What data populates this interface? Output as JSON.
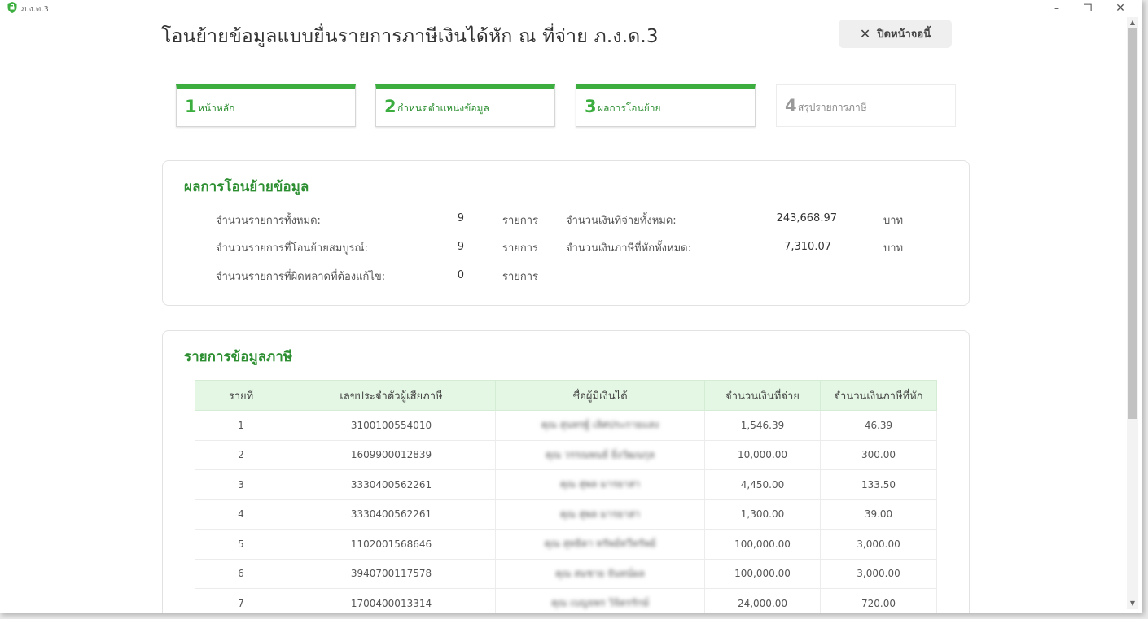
{
  "window": {
    "app_name": "ภ.ง.ด.3",
    "minimize": "–",
    "restore": "❐",
    "close": "✕"
  },
  "header": {
    "title": "โอนย้ายข้อมูลแบบยื่นรายการภาษีเงินได้หัก ณ ที่จ่าย ภ.ง.ด.3",
    "close_button": "ปิดหน้าจอนี้",
    "close_icon": "✕"
  },
  "steps": [
    {
      "number": "1",
      "label": "หน้าหลัก",
      "state": "done"
    },
    {
      "number": "2",
      "label": "กำหนดตำแหน่งข้อมูล",
      "state": "done"
    },
    {
      "number": "3",
      "label": "ผลการโอนย้าย",
      "state": "current"
    },
    {
      "number": "4",
      "label": "สรุปรายการภาษี",
      "state": "pending"
    }
  ],
  "summary": {
    "title": "ผลการโอนย้ายข้อมูล",
    "total_items_label": "จำนวนรายการทั้งหมด:",
    "total_items_value": "9",
    "complete_items_label": "จำนวนรายการที่โอนย้ายสมบูรณ์:",
    "complete_items_value": "9",
    "error_items_label": "จำนวนรายการที่ผิดพลาดที่ต้องแก้ไข:",
    "error_items_value": "0",
    "items_unit": "รายการ",
    "total_paid_label": "จำนวนเงินที่จ่ายทั้งหมด:",
    "total_paid_value": "243,668.97",
    "total_tax_label": "จำนวนเงินภาษีที่หักทั้งหมด:",
    "total_tax_value": "7,310.07",
    "money_unit": "บาท"
  },
  "tax_table": {
    "title": "รายการข้อมูลภาษี",
    "columns": [
      "รายที่",
      "เลขประจำตัวผู้เสียภาษี",
      "ชื่อผู้มีเงินได้",
      "จำนวนเงินที่จ่าย",
      "จำนวนเงินภาษีที่หัก"
    ],
    "rows": [
      {
        "no": "1",
        "tax_id": "3100100554010",
        "name": "คุณ สุนทรฐ์ เลิศประกายแสง",
        "paid": "1,546.39",
        "tax": "46.39"
      },
      {
        "no": "2",
        "tax_id": "1609900012839",
        "name": "คุณ วรรณพนธ์ ยิ่งวัฒนกุล",
        "paid": "10,000.00",
        "tax": "300.00"
      },
      {
        "no": "3",
        "tax_id": "3330400562261",
        "name": "คุณ สุพล มารยาสา",
        "paid": "4,450.00",
        "tax": "133.50"
      },
      {
        "no": "4",
        "tax_id": "3330400562261",
        "name": "คุณ สุพล มารยาสา",
        "paid": "1,300.00",
        "tax": "39.00"
      },
      {
        "no": "5",
        "tax_id": "1102001568646",
        "name": "คุณ สุทธิดา ทรัพย์ทวีทรัพย์",
        "paid": "100,000.00",
        "tax": "3,000.00"
      },
      {
        "no": "6",
        "tax_id": "3940700117578",
        "name": "คุณ สมชาย จันทน์ผล",
        "paid": "100,000.00",
        "tax": "3,000.00"
      },
      {
        "no": "7",
        "tax_id": "1700400013314",
        "name": "คุณ เบญจพร วิจิตรรักษ์",
        "paid": "24,000.00",
        "tax": "720.00"
      }
    ]
  },
  "colors": {
    "accent": "#3cae3f",
    "accent_text": "#2d8f32",
    "table_header_bg": "#e4f7e4"
  }
}
